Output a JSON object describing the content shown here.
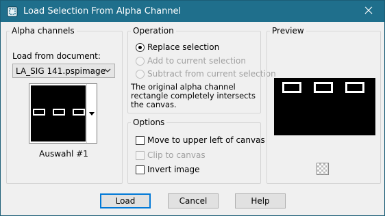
{
  "window": {
    "title": "Load Selection From Alpha Channel",
    "close_icon": "close-icon",
    "app_icon": "app-icon"
  },
  "alpha_channels": {
    "group_label": "Alpha channels",
    "load_from_label": "Load from document:",
    "document_selected": "LA_SIG 141.pspimage",
    "channel_name": "Auswahl #1",
    "thumbnail_boxes": 3
  },
  "operation": {
    "group_label": "Operation",
    "options": [
      {
        "label": "Replace selection",
        "selected": true,
        "enabled": true
      },
      {
        "label": "Add to current selection",
        "selected": false,
        "enabled": false
      },
      {
        "label": "Subtract from current selection",
        "selected": false,
        "enabled": false
      }
    ],
    "note": "The original alpha channel rectangle completely intersects the canvas."
  },
  "options": {
    "group_label": "Options",
    "checkboxes": [
      {
        "label": "Move to upper left of canvas",
        "checked": false,
        "enabled": true
      },
      {
        "label": "Clip to canvas",
        "checked": false,
        "enabled": false
      },
      {
        "label": "Invert image",
        "checked": false,
        "enabled": true
      }
    ]
  },
  "preview": {
    "group_label": "Preview",
    "boxes": 3,
    "transparency_icon": "checkerboard-icon"
  },
  "buttons": {
    "load": "Load",
    "cancel": "Cancel",
    "help": "Help"
  },
  "colors": {
    "titlebar": "#1f6f8c",
    "accent": "#0078d7"
  }
}
